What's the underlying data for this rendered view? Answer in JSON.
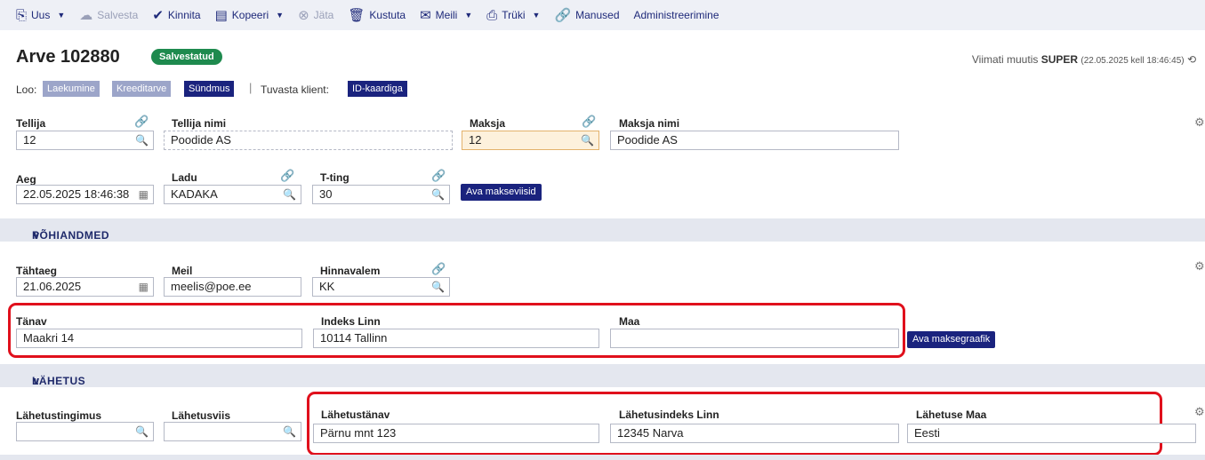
{
  "toolbar": {
    "new": "Uus",
    "save": "Salvesta",
    "confirm": "Kinnita",
    "copy": "Kopeeri",
    "leave": "Jäta",
    "delete": "Kustuta",
    "email": "Meili",
    "print": "Trüki",
    "attachments": "Manused",
    "admin": "Administreerimine"
  },
  "header": {
    "title": "Arve 102880",
    "status": "Salvestatud",
    "modified_prefix": "Viimati muutis",
    "modified_user": "SUPER",
    "modified_when": "(22.05.2025 kell 18:46:45)"
  },
  "create": {
    "label": "Loo:",
    "payment": "Laekumine",
    "credit": "Kreeditarve",
    "event": "Sündmus",
    "identify_label": "Tuvasta klient:",
    "id_card": "ID-kaardiga"
  },
  "fields": {
    "tellija": {
      "label": "Tellija",
      "value": "12"
    },
    "tellija_nimi": {
      "label": "Tellija nimi",
      "value": "Poodide AS"
    },
    "maksja": {
      "label": "Maksja",
      "value": "12"
    },
    "maksja_nimi": {
      "label": "Maksja nimi",
      "value": "Poodide AS"
    },
    "aeg": {
      "label": "Aeg",
      "value": "22.05.2025 18:46:38"
    },
    "ladu": {
      "label": "Ladu",
      "value": "KADAKA"
    },
    "tting": {
      "label": "T-ting",
      "value": "30"
    },
    "open_payment_methods": "Ava makseviisid"
  },
  "sections": {
    "main": "PÕHIANDMED",
    "shipping": "LÄHETUS"
  },
  "main": {
    "tahtaeg": {
      "label": "Tähtaeg",
      "value": "21.06.2025"
    },
    "meil": {
      "label": "Meil",
      "value": "meelis@poe.ee"
    },
    "hinnavalem": {
      "label": "Hinnavalem",
      "value": "KK"
    },
    "tanav": {
      "label": "Tänav",
      "value": "Maakri 14"
    },
    "indeks_linn": {
      "label": "Indeks Linn",
      "value": "10114 Tallinn"
    },
    "maa": {
      "label": "Maa",
      "value": ""
    },
    "open_schedule": "Ava maksegraafik"
  },
  "shipping": {
    "tingimus": {
      "label": "Lähetustingimus",
      "value": ""
    },
    "viis": {
      "label": "Lähetusviis",
      "value": ""
    },
    "tanav": {
      "label": "Lähetustänav",
      "value": "Pärnu mnt 123"
    },
    "indeks_linn": {
      "label": "Lähetusindeks Linn",
      "value": "12345 Narva"
    },
    "maa": {
      "label": "Lähetuse Maa",
      "value": "Eesti"
    }
  },
  "colors": {
    "accent": "#1a237e",
    "status_green": "#1e8a4e",
    "highlight": "#e0101c"
  }
}
